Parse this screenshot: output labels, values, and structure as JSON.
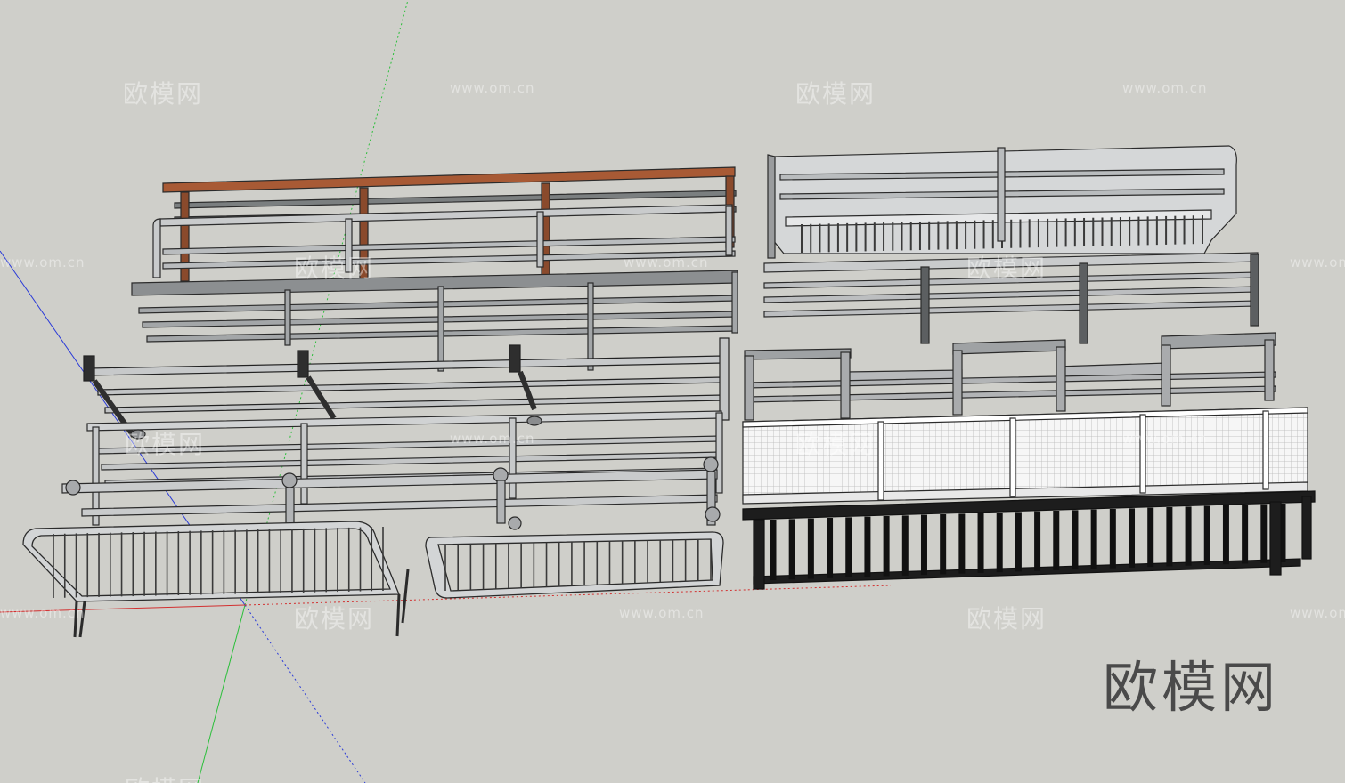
{
  "brand_text": "欧模网",
  "watermarks": [
    {
      "text": "欧模网",
      "kind": "cn"
    },
    {
      "text": "www.om.cn",
      "kind": "url"
    },
    {
      "text": "欧模网",
      "kind": "cn"
    },
    {
      "text": "www.om.cn",
      "kind": "url"
    },
    {
      "text": "www.om.cn",
      "kind": "url"
    },
    {
      "text": "欧模网",
      "kind": "cn"
    },
    {
      "text": "www.om.cn",
      "kind": "url"
    },
    {
      "text": "欧模网",
      "kind": "cn"
    },
    {
      "text": "www.om.cn",
      "kind": "url"
    },
    {
      "text": "欧模网",
      "kind": "cn"
    },
    {
      "text": "www.om.cn",
      "kind": "url"
    },
    {
      "text": "欧模网",
      "kind": "cn"
    },
    {
      "text": "www.om.cn",
      "kind": "url"
    },
    {
      "text": "欧模网",
      "kind": "cn"
    },
    {
      "text": "www.om.cn",
      "kind": "url"
    },
    {
      "text": "欧模网",
      "kind": "cn"
    },
    {
      "text": "www.om.cn",
      "kind": "url"
    },
    {
      "text": "欧模网",
      "kind": "cn"
    },
    {
      "text": "www.om.cn",
      "kind": "url"
    }
  ],
  "colors": {
    "background": "#cfcfca",
    "axis_red": "#d23030",
    "axis_green": "#2bbf3a",
    "axis_blue": "#2a3ad8",
    "steel": "#b9bcbe",
    "dark_steel": "#3a3a3a",
    "wood": "#a85a35",
    "mesh_panel": "#f4f4f4"
  },
  "models": [
    {
      "icon": "wood-handrail-railing-model"
    },
    {
      "icon": "steel-pipe-railing-model"
    },
    {
      "icon": "gray-pipe-railing-model"
    },
    {
      "icon": "dark-post-railing-model"
    },
    {
      "icon": "round-pipe-railing-model"
    },
    {
      "icon": "stanchion-railing-model"
    },
    {
      "icon": "barricade-fence-model"
    },
    {
      "icon": "low-barricade-model"
    },
    {
      "icon": "baluster-railing-model"
    },
    {
      "icon": "bench-frame-railing-model"
    },
    {
      "icon": "post-cap-railing-model"
    },
    {
      "icon": "mesh-panel-railing-model"
    },
    {
      "icon": "black-iron-railing-model"
    }
  ]
}
